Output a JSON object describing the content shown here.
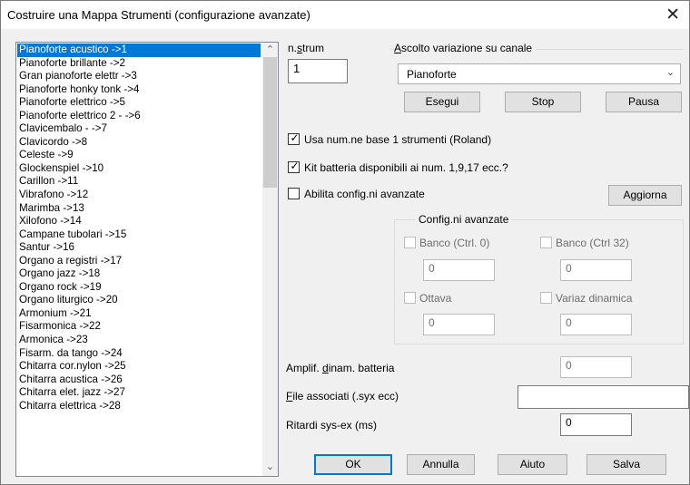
{
  "dialog": {
    "title": "Costruire una Mappa Strumenti (configurazione avanzate)",
    "close_glyph": "✕"
  },
  "instrument_list": {
    "selected_index": 0,
    "items": [
      "Pianoforte acustico  ->1",
      "Pianoforte brillante  ->2",
      "Gran pianoforte elettr  ->3",
      "Pianoforte honky tonk  ->4",
      "Pianoforte elettrico  ->5",
      "Pianoforte elettrico 2 -  ->6",
      "Clavicembalo -  ->7",
      "Clavicordo   ->8",
      "Celeste  ->9",
      "Glockenspiel  ->10",
      "Carillon  ->11",
      "Vibrafono  ->12",
      "Marimba  ->13",
      "Xilofono  ->14",
      "Campane tubolari  ->15",
      "Santur  ->16",
      "Organo a registri  ->17",
      "Organo jazz  ->18",
      "Organo rock  ->19",
      "Organo liturgico  ->20",
      "Armonium  ->21",
      "Fisarmonica  ->22",
      "Armonica  ->23",
      "Fisarm. da tango  ->24",
      "Chitarra cor.nylon  ->25",
      "Chitarra acustica  ->26",
      "Chitarra elet. jazz  ->27",
      "Chitarra elettrica  ->28"
    ]
  },
  "nstrum": {
    "label_pre": "n.",
    "label_ul": "s",
    "label_post": "trum",
    "value": "1"
  },
  "channel_group": {
    "label_ul": "A",
    "label_rest": "scolto variazione su canale",
    "selected": "Pianoforte",
    "buttons": {
      "run": "Esegui",
      "stop": "Stop",
      "pause": "Pausa"
    }
  },
  "options": {
    "base1": {
      "label": "Usa num.ne base 1 strumenti (Roland)",
      "checked": "✓"
    },
    "drum_kits": {
      "label": "Kit batteria disponibili ai num. 1,9,17 ecc.?",
      "checked": "✓"
    },
    "advanced": {
      "label": "Abilita config.ni avanzate"
    }
  },
  "update_button": "Aggiorna",
  "advanced": {
    "group_label": "Config.ni avanzate",
    "bank0": {
      "label": "Banco (Ctrl. 0)",
      "value": "0"
    },
    "bank32": {
      "label": "Banco (Ctrl 32)",
      "value": "0"
    },
    "octave": {
      "label": "Ottava",
      "value": "0"
    },
    "dynamics": {
      "label": "Variaz dinamica",
      "value": "0"
    }
  },
  "drum_amp": {
    "label_pre": "Amplif. ",
    "label_ul": "d",
    "label_post": "inam. batteria",
    "value": "0"
  },
  "assoc_files": {
    "label_ul": "F",
    "label_post": "ile associati (.syx ecc)",
    "value": ""
  },
  "sysex_delay": {
    "label": "Ritardi sys-ex (ms)",
    "value": "0"
  },
  "footer": {
    "ok": "OK",
    "cancel": "Annulla",
    "help": "Aiuto",
    "save": "Salva"
  }
}
